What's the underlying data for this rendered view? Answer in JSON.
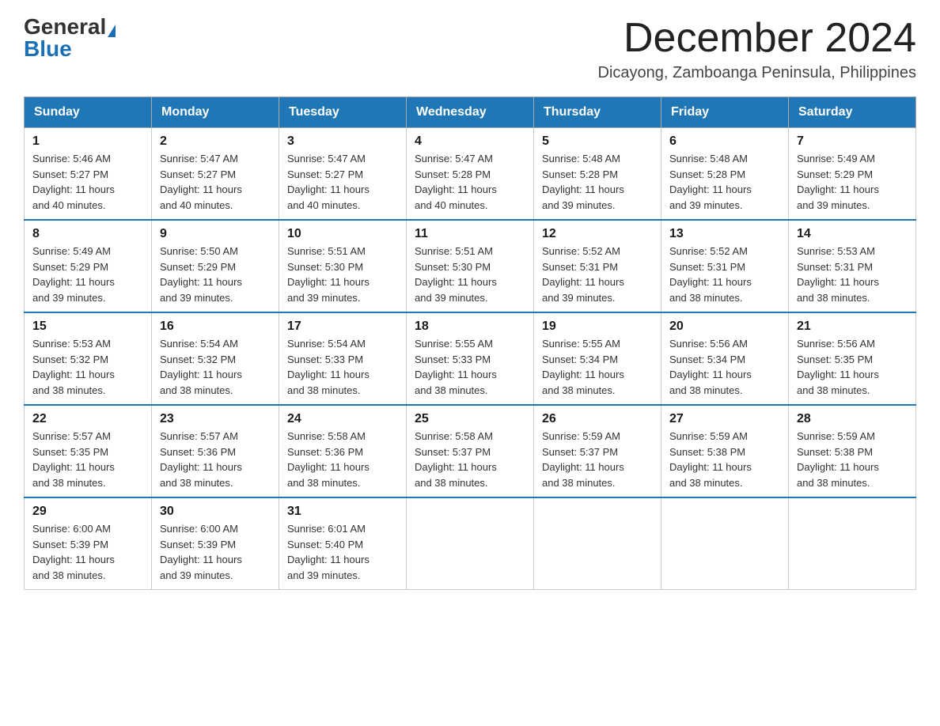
{
  "header": {
    "logo_general": "General",
    "logo_blue": "Blue",
    "month_title": "December 2024",
    "subtitle": "Dicayong, Zamboanga Peninsula, Philippines"
  },
  "days_of_week": [
    "Sunday",
    "Monday",
    "Tuesday",
    "Wednesday",
    "Thursday",
    "Friday",
    "Saturday"
  ],
  "weeks": [
    [
      {
        "day": "1",
        "sunrise": "5:46 AM",
        "sunset": "5:27 PM",
        "daylight": "11 hours and 40 minutes."
      },
      {
        "day": "2",
        "sunrise": "5:47 AM",
        "sunset": "5:27 PM",
        "daylight": "11 hours and 40 minutes."
      },
      {
        "day": "3",
        "sunrise": "5:47 AM",
        "sunset": "5:27 PM",
        "daylight": "11 hours and 40 minutes."
      },
      {
        "day": "4",
        "sunrise": "5:47 AM",
        "sunset": "5:28 PM",
        "daylight": "11 hours and 40 minutes."
      },
      {
        "day": "5",
        "sunrise": "5:48 AM",
        "sunset": "5:28 PM",
        "daylight": "11 hours and 39 minutes."
      },
      {
        "day": "6",
        "sunrise": "5:48 AM",
        "sunset": "5:28 PM",
        "daylight": "11 hours and 39 minutes."
      },
      {
        "day": "7",
        "sunrise": "5:49 AM",
        "sunset": "5:29 PM",
        "daylight": "11 hours and 39 minutes."
      }
    ],
    [
      {
        "day": "8",
        "sunrise": "5:49 AM",
        "sunset": "5:29 PM",
        "daylight": "11 hours and 39 minutes."
      },
      {
        "day": "9",
        "sunrise": "5:50 AM",
        "sunset": "5:29 PM",
        "daylight": "11 hours and 39 minutes."
      },
      {
        "day": "10",
        "sunrise": "5:51 AM",
        "sunset": "5:30 PM",
        "daylight": "11 hours and 39 minutes."
      },
      {
        "day": "11",
        "sunrise": "5:51 AM",
        "sunset": "5:30 PM",
        "daylight": "11 hours and 39 minutes."
      },
      {
        "day": "12",
        "sunrise": "5:52 AM",
        "sunset": "5:31 PM",
        "daylight": "11 hours and 39 minutes."
      },
      {
        "day": "13",
        "sunrise": "5:52 AM",
        "sunset": "5:31 PM",
        "daylight": "11 hours and 38 minutes."
      },
      {
        "day": "14",
        "sunrise": "5:53 AM",
        "sunset": "5:31 PM",
        "daylight": "11 hours and 38 minutes."
      }
    ],
    [
      {
        "day": "15",
        "sunrise": "5:53 AM",
        "sunset": "5:32 PM",
        "daylight": "11 hours and 38 minutes."
      },
      {
        "day": "16",
        "sunrise": "5:54 AM",
        "sunset": "5:32 PM",
        "daylight": "11 hours and 38 minutes."
      },
      {
        "day": "17",
        "sunrise": "5:54 AM",
        "sunset": "5:33 PM",
        "daylight": "11 hours and 38 minutes."
      },
      {
        "day": "18",
        "sunrise": "5:55 AM",
        "sunset": "5:33 PM",
        "daylight": "11 hours and 38 minutes."
      },
      {
        "day": "19",
        "sunrise": "5:55 AM",
        "sunset": "5:34 PM",
        "daylight": "11 hours and 38 minutes."
      },
      {
        "day": "20",
        "sunrise": "5:56 AM",
        "sunset": "5:34 PM",
        "daylight": "11 hours and 38 minutes."
      },
      {
        "day": "21",
        "sunrise": "5:56 AM",
        "sunset": "5:35 PM",
        "daylight": "11 hours and 38 minutes."
      }
    ],
    [
      {
        "day": "22",
        "sunrise": "5:57 AM",
        "sunset": "5:35 PM",
        "daylight": "11 hours and 38 minutes."
      },
      {
        "day": "23",
        "sunrise": "5:57 AM",
        "sunset": "5:36 PM",
        "daylight": "11 hours and 38 minutes."
      },
      {
        "day": "24",
        "sunrise": "5:58 AM",
        "sunset": "5:36 PM",
        "daylight": "11 hours and 38 minutes."
      },
      {
        "day": "25",
        "sunrise": "5:58 AM",
        "sunset": "5:37 PM",
        "daylight": "11 hours and 38 minutes."
      },
      {
        "day": "26",
        "sunrise": "5:59 AM",
        "sunset": "5:37 PM",
        "daylight": "11 hours and 38 minutes."
      },
      {
        "day": "27",
        "sunrise": "5:59 AM",
        "sunset": "5:38 PM",
        "daylight": "11 hours and 38 minutes."
      },
      {
        "day": "28",
        "sunrise": "5:59 AM",
        "sunset": "5:38 PM",
        "daylight": "11 hours and 38 minutes."
      }
    ],
    [
      {
        "day": "29",
        "sunrise": "6:00 AM",
        "sunset": "5:39 PM",
        "daylight": "11 hours and 38 minutes."
      },
      {
        "day": "30",
        "sunrise": "6:00 AM",
        "sunset": "5:39 PM",
        "daylight": "11 hours and 39 minutes."
      },
      {
        "day": "31",
        "sunrise": "6:01 AM",
        "sunset": "5:40 PM",
        "daylight": "11 hours and 39 minutes."
      },
      null,
      null,
      null,
      null
    ]
  ],
  "labels": {
    "sunrise": "Sunrise:",
    "sunset": "Sunset:",
    "daylight": "Daylight:"
  }
}
